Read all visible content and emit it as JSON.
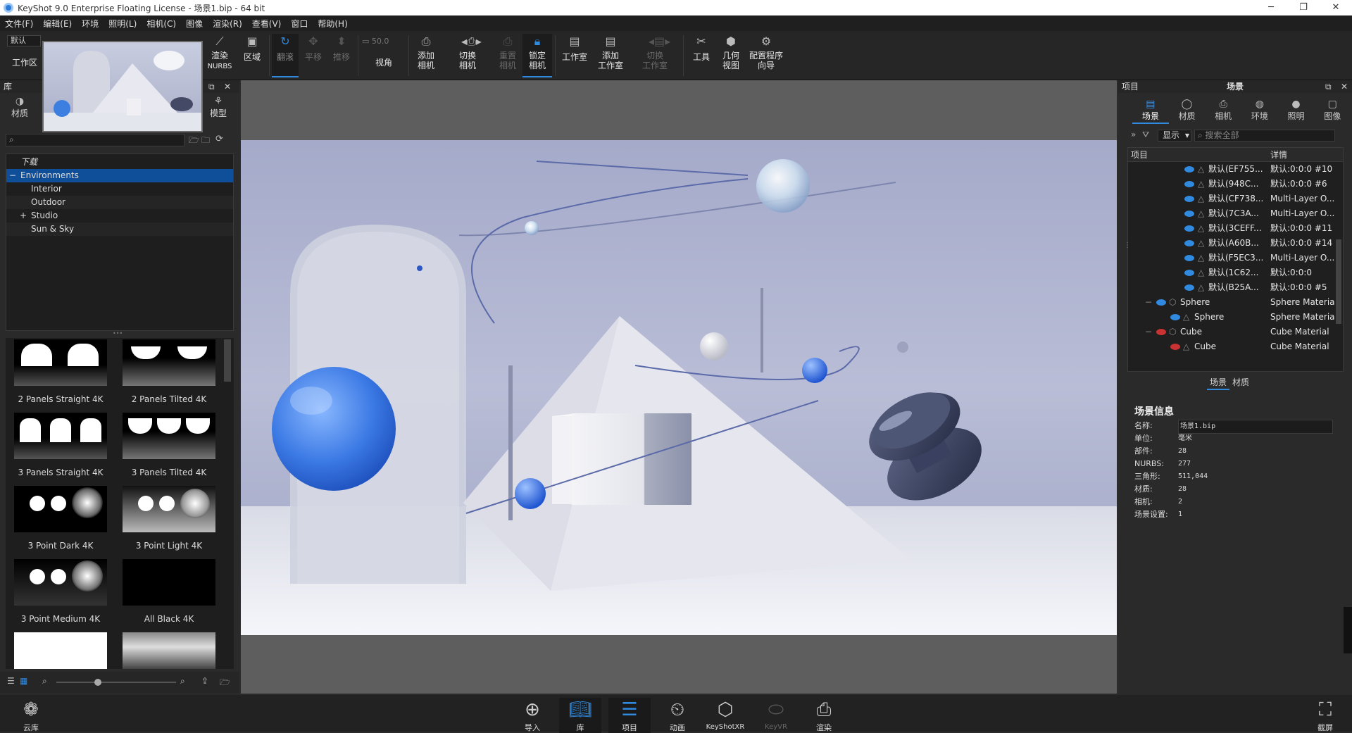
{
  "window": {
    "title": "KeyShot 9.0 Enterprise Floating License  - 场景1.bip  - 64 bit",
    "minimize": "─",
    "restore": "❐",
    "close": "✕"
  },
  "menu": [
    "文件(F)",
    "编辑(E)",
    "环境",
    "照明(L)",
    "相机(C)",
    "图像",
    "渲染(R)",
    "查看(V)",
    "窗口",
    "帮助(H)"
  ],
  "toolbar": {
    "workspace_default": "默认",
    "workspace_label": "工作区",
    "render_nurbs": [
      "渲染",
      "NURBS"
    ],
    "region": "区域",
    "tumble": "翻滚",
    "pan": "平移",
    "dolly": "推移",
    "fov_value": "50.0",
    "fov_label": "视角",
    "add_camera": [
      "添加",
      "相机"
    ],
    "switch_camera": [
      "切换",
      "相机"
    ],
    "reset_camera": [
      "重置",
      "相机"
    ],
    "lock_camera": [
      "锁定",
      "相机"
    ],
    "studio": "工作室",
    "add_studio": [
      "添加",
      "工作室"
    ],
    "switch_studio": [
      "切换",
      "工作室"
    ],
    "tools": "工具",
    "geometry_view": [
      "几何",
      "视图"
    ],
    "config_wizard": [
      "配置程序",
      "向导"
    ]
  },
  "library": {
    "title": "库",
    "tabs": [
      "材质",
      "模型"
    ],
    "tree": [
      {
        "label": "下载",
        "italic": true
      },
      {
        "label": "Environments",
        "expander": "−",
        "selected": true
      },
      {
        "label": "Interior"
      },
      {
        "label": "Outdoor"
      },
      {
        "label": "Studio",
        "expander": "+"
      },
      {
        "label": "Sun & Sky"
      }
    ],
    "thumbnails": [
      "2 Panels Straight 4K",
      "2 Panels Tilted 4K",
      "3 Panels Straight 4K",
      "3 Panels Tilted 4K",
      "3 Point Dark 4K",
      "3 Point Light 4K",
      "3 Point Medium 4K",
      "All Black 4K"
    ]
  },
  "project": {
    "title": "项目",
    "subtitle": "场景",
    "tabs": [
      "场景",
      "材质",
      "相机",
      "环境",
      "照明",
      "图像"
    ],
    "display_label": "显示",
    "search_placeholder": "搜索全部",
    "columns": [
      "项目",
      "详情"
    ],
    "rows": [
      {
        "name": "默认(EF755...",
        "detail": "默认:0:0:0 #10"
      },
      {
        "name": "默认(948C...",
        "detail": "默认:0:0:0 #6"
      },
      {
        "name": "默认(CF738...",
        "detail": "Multi-Layer O..."
      },
      {
        "name": "默认(7C3A...",
        "detail": "Multi-Layer O..."
      },
      {
        "name": "默认(3CEFF...",
        "detail": "默认:0:0:0 #11"
      },
      {
        "name": "默认(A60B...",
        "detail": "默认:0:0:0 #14"
      },
      {
        "name": "默认(F5EC3...",
        "detail": "Multi-Layer O..."
      },
      {
        "name": "默认(1C62...",
        "detail": "默认:0:0:0"
      },
      {
        "name": "默认(B25A...",
        "detail": "默认:0:0:0 #5"
      },
      {
        "name": "Sphere",
        "detail": "Sphere Materia"
      },
      {
        "name": "Sphere",
        "detail": "Sphere Materia"
      },
      {
        "name": "Cube",
        "detail": "Cube Material"
      },
      {
        "name": "Cube",
        "detail": "Cube Material"
      }
    ],
    "subtabs": [
      "场景",
      "材质"
    ],
    "info_title": "场景信息",
    "info": [
      {
        "k": "名称:",
        "v": "场景1.bip"
      },
      {
        "k": "单位:",
        "v": "毫米"
      },
      {
        "k": "部件:",
        "v": "28"
      },
      {
        "k": "NURBS:",
        "v": "277"
      },
      {
        "k": "三角形:",
        "v": "511,044"
      },
      {
        "k": "材质:",
        "v": "28"
      },
      {
        "k": "相机:",
        "v": "2"
      },
      {
        "k": "场景设置:",
        "v": "1"
      }
    ]
  },
  "bottom": {
    "cloud": "云库",
    "items": [
      "导入",
      "库",
      "项目",
      "动画",
      "KeyShotXR",
      "KeyVR",
      "渲染"
    ],
    "screenshot": "截屏"
  },
  "colors": {
    "accent": "#2f8ae0",
    "selection": "#0f4f9a",
    "eye_red": "#c83232"
  }
}
